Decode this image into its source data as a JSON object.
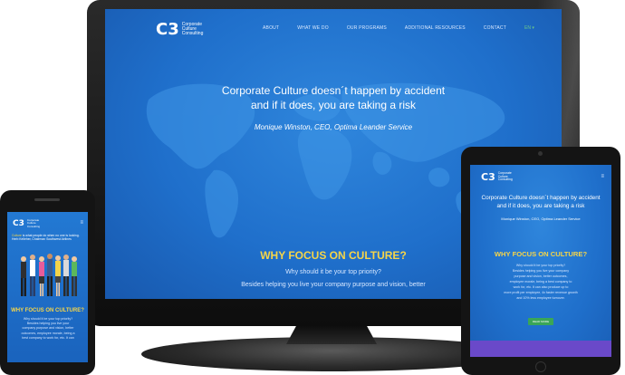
{
  "brand": {
    "name_lines": [
      "Corporate",
      "Culture",
      "Consulting"
    ],
    "mark": "C3"
  },
  "desktop": {
    "nav": [
      "ABOUT",
      "WHAT WE DO",
      "OUR PROGRAMS",
      "ADDITIONAL RESOURCES",
      "CONTACT"
    ],
    "language": "EN",
    "quote_line1": "Corporate Culture doesn´t happen by accident",
    "quote_line2": "and if it does, you are taking a risk",
    "author": "Monique Winston, CEO, Optima Leander Service",
    "section_title": "WHY FOCUS ON CULTURE?",
    "section_line1": "Why should it be your top priority?",
    "section_line2": "Besides helping you live your company purpose and vision, better"
  },
  "tablet": {
    "quote_line1": "Corporate Culture doesn´t happen by accident",
    "quote_line2": "and if it does, you are taking a risk",
    "author": "Monique Winston, CEO, Optima Leander Service",
    "section_title": "WHY FOCUS ON CULTURE?",
    "body_lines": [
      "Why should it be your top priority?",
      "Besides helping you live your company",
      "purpose and vision, better outcomes,",
      "employee morale, being a best company to",
      "work for, etc. It can also produce up to",
      "more profit per employee, 4x faster revenue growth",
      "and 10% less employee turnover."
    ],
    "button": "READ MORE"
  },
  "phone": {
    "tag_highlight": "Culture",
    "tag_rest": " is what people do when no one is looking.",
    "tag_author": "Herb Kelleher, Chairman Southwest Airlines",
    "section_title": "WHY FOCUS ON CULTURE?",
    "body_lines": [
      "Why should it be your top priority?",
      "Besides helping you live your",
      "company purpose and vision, better",
      "outcomes, employee morale, being a",
      "best company to work for, etc. It can"
    ]
  },
  "colors": {
    "screen_blue": "#1f6fcb",
    "title_yellow": "#f6d548",
    "button_green": "#3aa657",
    "band_purple": "#6a49c9",
    "bezel": "#141414"
  }
}
